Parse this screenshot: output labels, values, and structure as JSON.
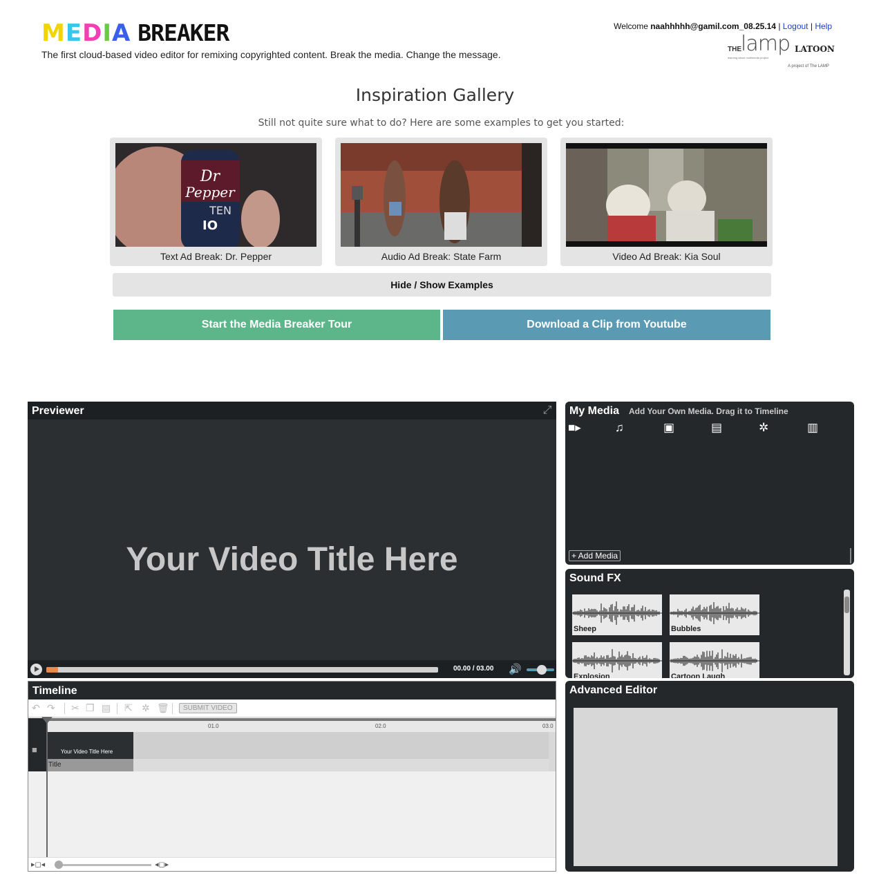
{
  "header": {
    "logo_media_letters": [
      "M",
      "E",
      "D",
      "I",
      "A"
    ],
    "logo_media_colors": [
      "#f2d400",
      "#35c8e8",
      "#f23fb4",
      "#6cc84a",
      "#3a5fe8"
    ],
    "logo_breaker": "BREAKER",
    "tagline": "The first cloud-based video editor for remixing copyrighted content. Break the media. Change the message.",
    "welcome_prefix": "Welcome",
    "username": "naahhhhh@gamil.com_08.25.14",
    "separator": "|",
    "logout": "Logout",
    "help": "Help",
    "partner": {
      "the": "THE",
      "lamp": "lamp",
      "latoon": "LATOON",
      "tiny": "learning about multimedia project",
      "project_of": "A project of The LAMP"
    }
  },
  "gallery": {
    "title": "Inspiration Gallery",
    "subtitle": "Still not quite sure what to do? Here are some examples to get you started:",
    "examples": [
      {
        "caption": "Text Ad Break: Dr. Pepper"
      },
      {
        "caption": "Audio Ad Break: State Farm"
      },
      {
        "caption": "Video Ad Break: Kia Soul"
      }
    ],
    "toggle_label": "Hide / Show Examples",
    "tour_button": "Start the Media Breaker Tour",
    "youtube_button": "Download a Clip from Youtube"
  },
  "previewer": {
    "title": "Previewer",
    "video_title": "Your Video Title Here",
    "time_display": "00.00 / 03.00",
    "progress_fraction": 0.03,
    "volume_fraction": 0.55
  },
  "timeline": {
    "title": "Timeline",
    "submit_label": "SUBMIT VIDEO",
    "ruler_marks": [
      "01.0",
      "02.0",
      "03.0"
    ],
    "clip_title": "Your Video Title Here",
    "clip_label": "Title",
    "zoom_fraction": 0.0
  },
  "my_media": {
    "title": "My Media",
    "subtitle": "Add Your Own Media. Drag it to Timeline",
    "tabs": [
      "video-icon",
      "music-icon",
      "image-icon",
      "caption-icon",
      "settings-icon",
      "filmstrip-icon"
    ],
    "add_media_label": "+ Add Media"
  },
  "sound_fx": {
    "title": "Sound FX",
    "items": [
      {
        "name": "Sheep"
      },
      {
        "name": "Bubbles"
      },
      {
        "name": "Explosion"
      },
      {
        "name": "Cartoon Laugh"
      }
    ]
  },
  "advanced_editor": {
    "title": "Advanced Editor"
  },
  "colors": {
    "panel_dark": "#25282a",
    "tour_green": "#5cb68a",
    "youtube_blue": "#5a9ab3",
    "progress_orange": "#e88a4c"
  }
}
